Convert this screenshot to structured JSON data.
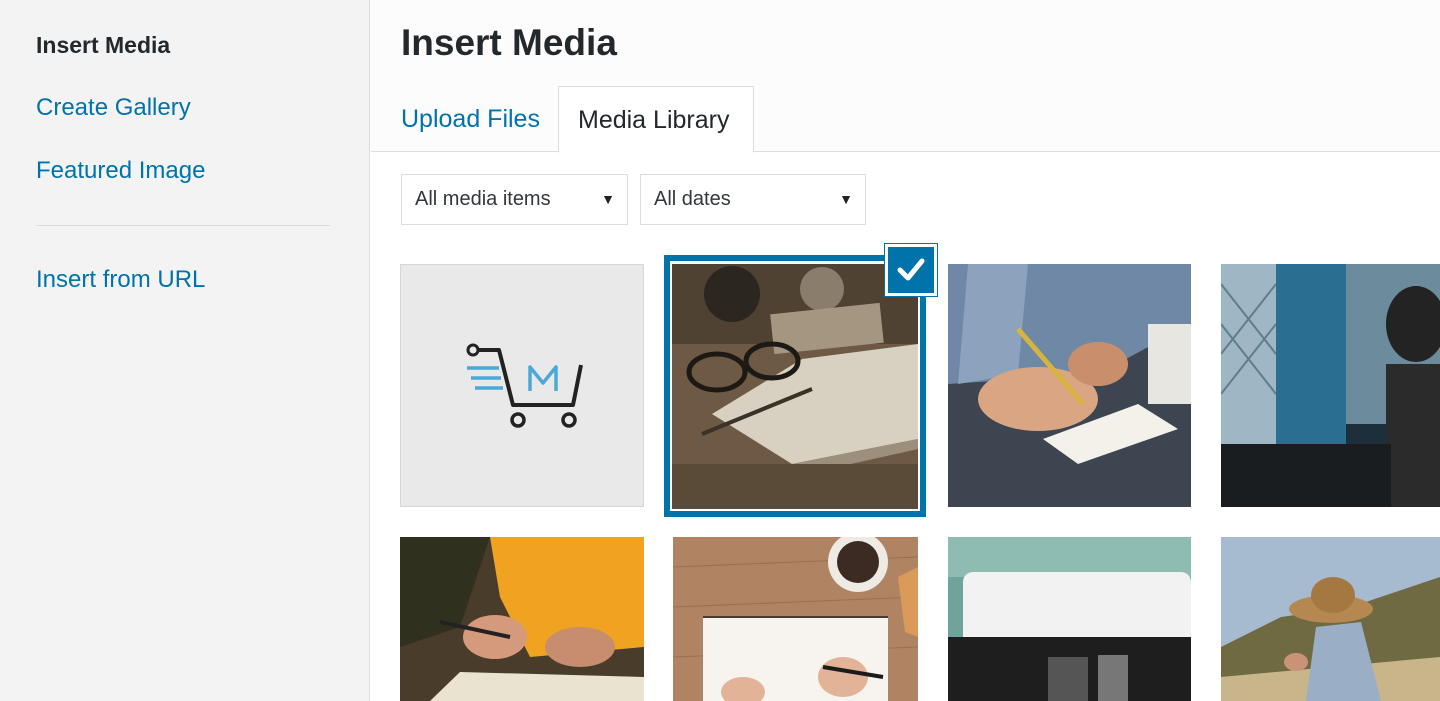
{
  "sidebar": {
    "items": [
      {
        "label": "Insert Media",
        "active": true
      },
      {
        "label": "Create Gallery"
      },
      {
        "label": "Featured Image"
      },
      {
        "label": "Insert from URL"
      }
    ]
  },
  "header": {
    "title": "Insert Media",
    "tabs": [
      {
        "label": "Upload Files"
      },
      {
        "label": "Media Library",
        "active": true
      }
    ]
  },
  "filters": {
    "type": {
      "selected": "All media items"
    },
    "date": {
      "selected": "All dates"
    }
  },
  "media": {
    "items": [
      {
        "icon": "shopping-cart-logo-icon",
        "selected": false
      },
      {
        "icon": "notebook-glasses-photo",
        "selected": true
      },
      {
        "icon": "hand-writing-photo",
        "selected": false
      },
      {
        "icon": "woman-window-photo",
        "selected": false
      },
      {
        "icon": "yellow-sleeve-book-photo",
        "selected": false
      },
      {
        "icon": "notebook-coffee-photo",
        "selected": false
      },
      {
        "icon": "typewriter-photo",
        "selected": false
      },
      {
        "icon": "hat-person-photo",
        "selected": false
      }
    ]
  },
  "colors": {
    "accent": "#0073aa",
    "text": "#23282d",
    "sidebar_bg": "#f3f3f3"
  }
}
